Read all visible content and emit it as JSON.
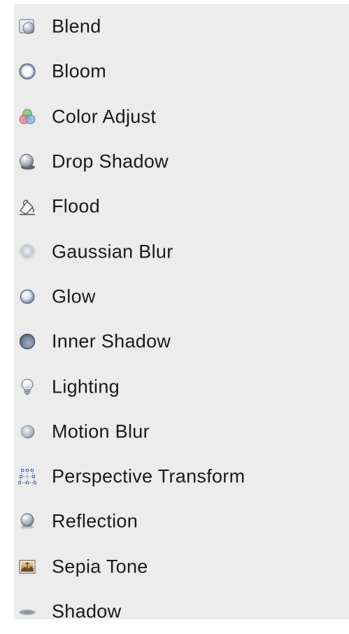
{
  "effects": {
    "items": [
      {
        "label": "Blend",
        "icon": "blend-icon"
      },
      {
        "label": "Bloom",
        "icon": "bloom-icon"
      },
      {
        "label": "Color Adjust",
        "icon": "color-adjust-icon"
      },
      {
        "label": "Drop Shadow",
        "icon": "drop-shadow-icon"
      },
      {
        "label": "Flood",
        "icon": "flood-icon"
      },
      {
        "label": "Gaussian Blur",
        "icon": "gaussian-blur-icon"
      },
      {
        "label": "Glow",
        "icon": "glow-icon"
      },
      {
        "label": "Inner Shadow",
        "icon": "inner-shadow-icon"
      },
      {
        "label": "Lighting",
        "icon": "lighting-bulb-icon"
      },
      {
        "label": "Motion Blur",
        "icon": "motion-blur-icon"
      },
      {
        "label": "Perspective Transform",
        "icon": "perspective-transform-icon"
      },
      {
        "label": "Reflection",
        "icon": "reflection-icon"
      },
      {
        "label": "Sepia Tone",
        "icon": "sepia-tone-icon"
      },
      {
        "label": "Shadow",
        "icon": "shadow-icon"
      }
    ]
  },
  "colors": {
    "panel_background": "#ececec",
    "text": "#1a1a1a"
  }
}
